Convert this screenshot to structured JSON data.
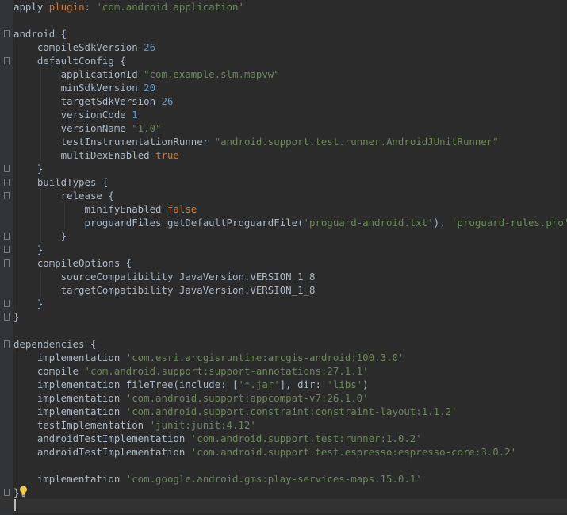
{
  "editor": {
    "language": "Gradle (Groovy)",
    "colors": {
      "background": "#2b2b2b",
      "text": "#a9b7c6",
      "string": "#6a8759",
      "number": "#6897bb",
      "keyword": "#cc7832"
    },
    "lines": [
      [
        {
          "t": "plain",
          "v": "apply "
        },
        {
          "t": "kw",
          "v": "plugin"
        },
        {
          "t": "plain",
          "v": ": "
        },
        {
          "t": "str",
          "v": "'com.android.application'"
        }
      ],
      [],
      [
        {
          "t": "plain",
          "v": "android {"
        }
      ],
      [
        {
          "t": "plain",
          "v": "    compileSdkVersion "
        },
        {
          "t": "num",
          "v": "26"
        }
      ],
      [
        {
          "t": "plain",
          "v": "    defaultConfig {"
        }
      ],
      [
        {
          "t": "plain",
          "v": "        applicationId "
        },
        {
          "t": "str",
          "v": "\"com.example.slm.mapvw\""
        }
      ],
      [
        {
          "t": "plain",
          "v": "        minSdkVersion "
        },
        {
          "t": "num",
          "v": "20"
        }
      ],
      [
        {
          "t": "plain",
          "v": "        targetSdkVersion "
        },
        {
          "t": "num",
          "v": "26"
        }
      ],
      [
        {
          "t": "plain",
          "v": "        versionCode "
        },
        {
          "t": "num",
          "v": "1"
        }
      ],
      [
        {
          "t": "plain",
          "v": "        versionName "
        },
        {
          "t": "str",
          "v": "\"1.0\""
        }
      ],
      [
        {
          "t": "plain",
          "v": "        testInstrumentationRunner "
        },
        {
          "t": "str",
          "v": "\"android.support.test.runner.AndroidJUnitRunner\""
        }
      ],
      [
        {
          "t": "plain",
          "v": "        multiDexEnabled "
        },
        {
          "t": "kw",
          "v": "true"
        }
      ],
      [
        {
          "t": "plain",
          "v": "    }"
        }
      ],
      [
        {
          "t": "plain",
          "v": "    buildTypes {"
        }
      ],
      [
        {
          "t": "plain",
          "v": "        release {"
        }
      ],
      [
        {
          "t": "plain",
          "v": "            minifyEnabled "
        },
        {
          "t": "kw",
          "v": "false"
        }
      ],
      [
        {
          "t": "plain",
          "v": "            proguardFiles getDefaultProguardFile("
        },
        {
          "t": "str",
          "v": "'proguard-android.txt'"
        },
        {
          "t": "plain",
          "v": "), "
        },
        {
          "t": "str",
          "v": "'proguard-rules.pro'"
        }
      ],
      [
        {
          "t": "plain",
          "v": "        }"
        }
      ],
      [
        {
          "t": "plain",
          "v": "    }"
        }
      ],
      [
        {
          "t": "plain",
          "v": "    compileOptions {"
        }
      ],
      [
        {
          "t": "plain",
          "v": "        sourceCompatibility JavaVersion.VERSION_1_8"
        }
      ],
      [
        {
          "t": "plain",
          "v": "        targetCompatibility JavaVersion.VERSION_1_8"
        }
      ],
      [
        {
          "t": "plain",
          "v": "    }"
        }
      ],
      [
        {
          "t": "plain",
          "v": "}"
        }
      ],
      [],
      [
        {
          "t": "plain",
          "v": "dependencies {"
        }
      ],
      [
        {
          "t": "plain",
          "v": "    implementation "
        },
        {
          "t": "str",
          "v": "'com.esri.arcgisruntime:arcgis-android:100.3.0'"
        }
      ],
      [
        {
          "t": "plain",
          "v": "    compile "
        },
        {
          "t": "str",
          "v": "'com.android.support:support-annotations:27.1.1'"
        }
      ],
      [
        {
          "t": "plain",
          "v": "    implementation fileTree(include: ["
        },
        {
          "t": "str",
          "v": "'*.jar'"
        },
        {
          "t": "plain",
          "v": "], dir: "
        },
        {
          "t": "str",
          "v": "'libs'"
        },
        {
          "t": "plain",
          "v": ")"
        }
      ],
      [
        {
          "t": "plain",
          "v": "    implementation "
        },
        {
          "t": "str",
          "v": "'com.android.support:appcompat-v7:26.1.0'"
        }
      ],
      [
        {
          "t": "plain",
          "v": "    implementation "
        },
        {
          "t": "str",
          "v": "'com.android.support.constraint:constraint-layout:1.1.2'"
        }
      ],
      [
        {
          "t": "plain",
          "v": "    testImplementation "
        },
        {
          "t": "str",
          "v": "'junit:junit:4.12'"
        }
      ],
      [
        {
          "t": "plain",
          "v": "    androidTestImplementation "
        },
        {
          "t": "str",
          "v": "'com.android.support.test:runner:1.0.2'"
        }
      ],
      [
        {
          "t": "plain",
          "v": "    androidTestImplementation "
        },
        {
          "t": "str",
          "v": "'com.android.support.test.espresso:espresso-core:3.0.2'"
        }
      ],
      [],
      [
        {
          "t": "plain",
          "v": "    implementation "
        },
        {
          "t": "str",
          "v": "'com.google.android.gms:play-services-maps:15.0.1'"
        }
      ],
      [
        {
          "t": "plain",
          "v": "}"
        }
      ],
      []
    ],
    "fold_markers": [
      {
        "line": 2,
        "kind": "open"
      },
      {
        "line": 4,
        "kind": "open"
      },
      {
        "line": 12,
        "kind": "close"
      },
      {
        "line": 13,
        "kind": "open"
      },
      {
        "line": 14,
        "kind": "open"
      },
      {
        "line": 17,
        "kind": "close"
      },
      {
        "line": 18,
        "kind": "close"
      },
      {
        "line": 19,
        "kind": "open"
      },
      {
        "line": 22,
        "kind": "close"
      },
      {
        "line": 23,
        "kind": "close"
      },
      {
        "line": 25,
        "kind": "open"
      },
      {
        "line": 36,
        "kind": "close"
      }
    ],
    "current_line": 37,
    "intention_icon": "lightbulb-icon"
  }
}
